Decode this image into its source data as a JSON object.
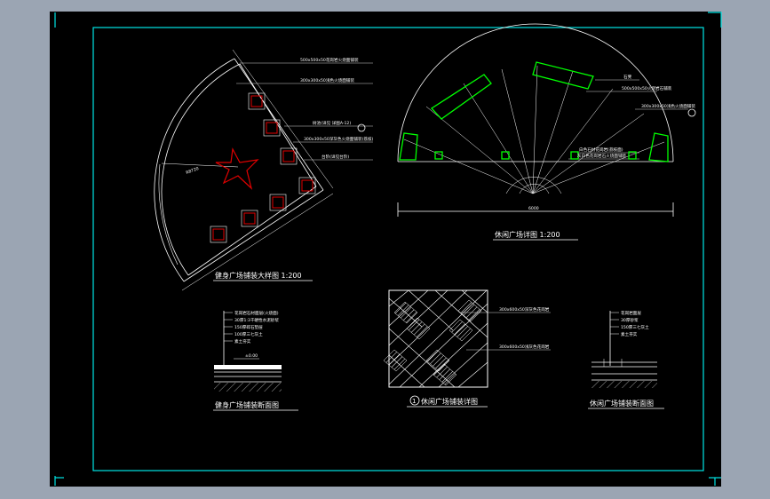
{
  "colors": {
    "viewport_bg": "#9ba5b3",
    "sheet_bg": "#000000",
    "frame": "#00e5e5",
    "line": "#ffffff",
    "red": "#e00000",
    "green": "#00ff00",
    "leader": "#d0d0d0"
  },
  "drawings": {
    "fitness_plaza_plan": {
      "title": "健身广场铺装大样图 1:200",
      "radius_label": "R8720",
      "labels": [
        "500x500x50花岗岩火烧面铺装",
        "300x300x50浅色火烧面铺装",
        "树池(详见 详图A-12)",
        "300x300x50深灰色火烧面铺装(荔枝)",
        "台阶(详见台阶)"
      ]
    },
    "leisure_plaza_plan": {
      "title": "休闲广场详图 1:200",
      "width_label": "6000",
      "labels": [
        "石凳",
        "500x500x50火烧岩石铺装",
        "300x300x50浅色火烧面铺装",
        "白色石材花岗岩(荔枝面)",
        "灰白色花岗岩石火烧面铺装"
      ]
    },
    "fitness_section": {
      "title": "健身广场铺装断面图",
      "level_label": "±0.00",
      "layers": [
        "花岗岩石材面层(火烧面)",
        "30厚1:3干硬性水泥砂浆",
        "150厚碎石垫层",
        "100厚三七灰土",
        "素土夯实"
      ]
    },
    "leisure_pattern": {
      "title": "休闲广场铺装详图",
      "index_mark": "1",
      "labels": [
        "300x600x50深灰色花岗岩",
        "300x600x50浅灰色花岗岩"
      ]
    },
    "leisure_section": {
      "title": "休闲广场铺装断面图",
      "layers": [
        "花岗岩面层",
        "30厚砂浆",
        "150厚三七灰土",
        "素土夯实"
      ]
    }
  }
}
